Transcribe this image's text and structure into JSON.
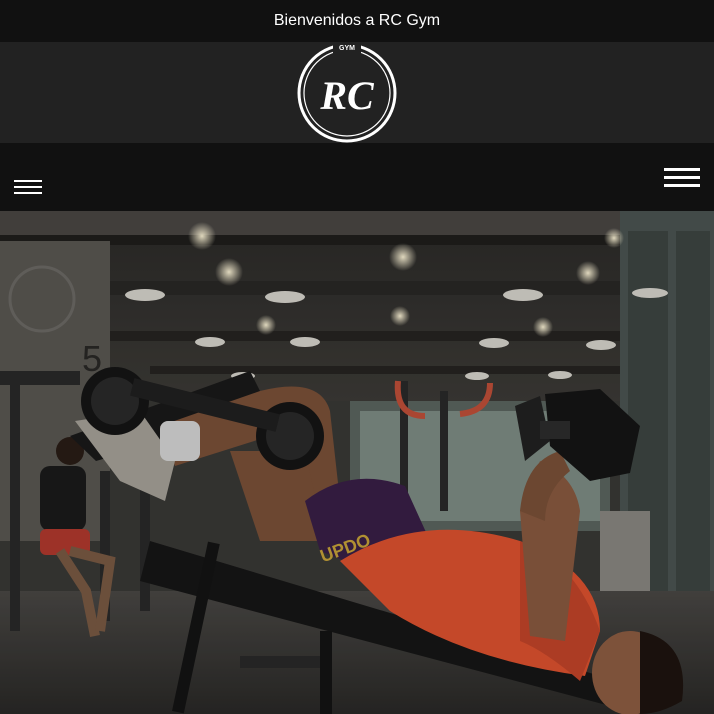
{
  "announcement": {
    "text": "Bienvenidos a RC Gym"
  },
  "logo": {
    "small_text": "GYM",
    "initials": "RC"
  },
  "nav": {
    "left_menu_icon": "hamburger-icon",
    "right_menu_icon": "hamburger-icon"
  },
  "hero": {
    "image": "gym-weightlifting-photo",
    "bench_print": "UPDO"
  },
  "colors": {
    "topbar": "#111111",
    "brandbar": "#222222",
    "accent_shirt": "#e0532f",
    "shorts": "#3a1f47"
  }
}
